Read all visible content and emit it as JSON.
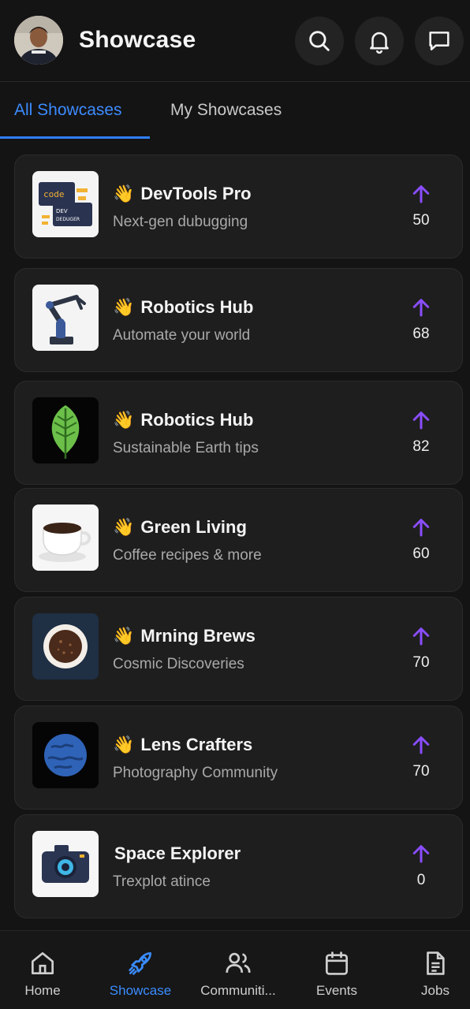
{
  "header": {
    "title": "Showcase",
    "icons": [
      "search-icon",
      "bell-icon",
      "chat-icon"
    ]
  },
  "tabs": [
    {
      "label": "All Showcases",
      "active": true
    },
    {
      "label": "My Showcases",
      "active": false
    }
  ],
  "cards": [
    {
      "title": "DevTools Pro",
      "subtitle": "Next-gen dubugging",
      "votes": "50",
      "emoji": "👋",
      "thumb": "code-devtools-image"
    },
    {
      "title": "Robotics Hub",
      "subtitle": "Automate your world",
      "votes": "68",
      "emoji": "👋",
      "thumb": "robot-arm-image"
    },
    {
      "title": "Robotics Hub",
      "subtitle": "Sustainable Earth tips",
      "votes": "82",
      "emoji": "👋",
      "thumb": "leaf-image"
    },
    {
      "title": "Green Living",
      "subtitle": "Coffee recipes & more",
      "votes": "60",
      "emoji": "👋",
      "thumb": "coffee-cup-image"
    },
    {
      "title": "Mrning Brews",
      "subtitle": "Cosmic Discoveries",
      "votes": "70",
      "emoji": "👋",
      "thumb": "coffee-top-image"
    },
    {
      "title": "Lens Crafters",
      "subtitle": "Photography Community",
      "votes": "70",
      "emoji": "👋",
      "thumb": "planet-image"
    },
    {
      "title": "Space Explorer",
      "subtitle": "Trexplot atince",
      "votes": "0",
      "emoji": "",
      "thumb": "camera-image"
    }
  ],
  "bottom_nav": [
    {
      "label": "Home",
      "icon": "home-icon",
      "active": false
    },
    {
      "label": "Showcase",
      "icon": "rocket-icon",
      "active": true
    },
    {
      "label": "Communiti...",
      "icon": "users-icon",
      "active": false
    },
    {
      "label": "Events",
      "icon": "calendar-icon",
      "active": false
    },
    {
      "label": "Jobs",
      "icon": "document-icon",
      "active": false
    }
  ],
  "colors": {
    "background": "#141414",
    "card": "#1e1e1e",
    "accent_blue": "#3a8cff",
    "upvote_purple": "#8a4dff"
  }
}
